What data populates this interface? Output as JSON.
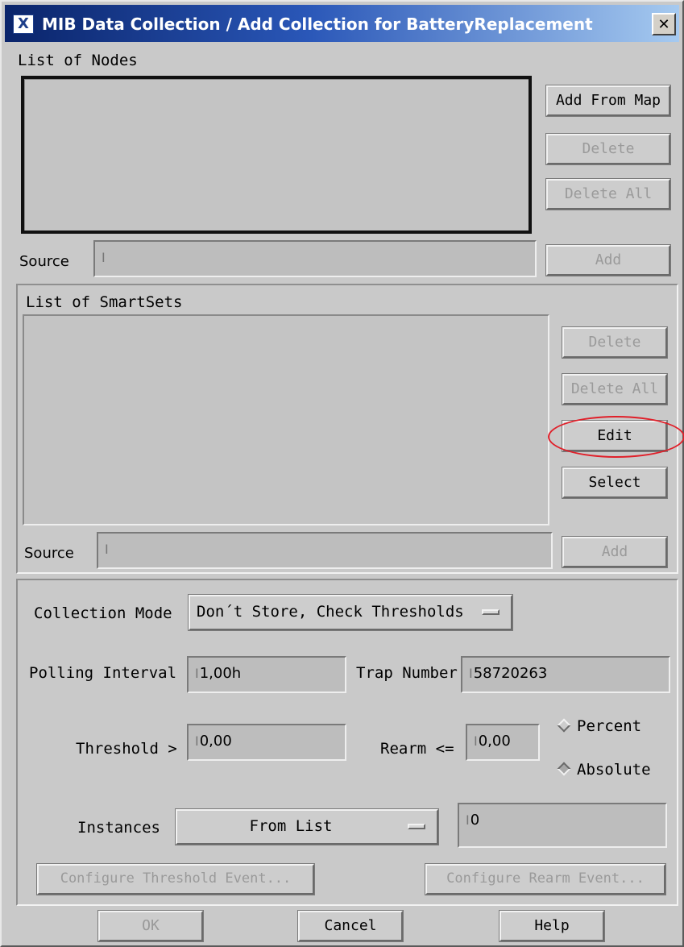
{
  "window": {
    "title": "MIB Data Collection / Add Collection for BatteryReplacement",
    "icon": "X",
    "close": "✕"
  },
  "nodes": {
    "label": "List of Nodes",
    "buttons": {
      "add_from_map": "Add From Map",
      "delete": "Delete",
      "delete_all": "Delete All"
    },
    "source_label": "Source",
    "source_value": "",
    "add_button": "Add"
  },
  "smartsets": {
    "label": "List of SmartSets",
    "buttons": {
      "delete": "Delete",
      "delete_all": "Delete All",
      "edit": "Edit",
      "select": "Select"
    },
    "source_label": "Source",
    "source_value": "",
    "add_button": "Add"
  },
  "settings": {
    "collection_mode_label": "Collection Mode",
    "collection_mode_value": "Don´t Store, Check Thresholds",
    "polling_interval_label": "Polling Interval",
    "polling_interval_value": "1,00h",
    "trap_number_label": "Trap Number",
    "trap_number_value": "58720263",
    "threshold_label": "Threshold >",
    "threshold_value": "0,00",
    "rearm_label": "Rearm <=",
    "rearm_value": "0,00",
    "percent_label": "Percent",
    "absolute_label": "Absolute",
    "selected_unit": "Absolute",
    "instances_label": "Instances",
    "instances_mode": "From List",
    "instances_value": "0",
    "configure_threshold_button": "Configure Threshold Event...",
    "configure_rearm_button": "Configure Rearm Event..."
  },
  "footer": {
    "ok": "OK",
    "cancel": "Cancel",
    "help": "Help"
  },
  "annotation": {
    "color": "#e0202a",
    "target": "Edit"
  }
}
